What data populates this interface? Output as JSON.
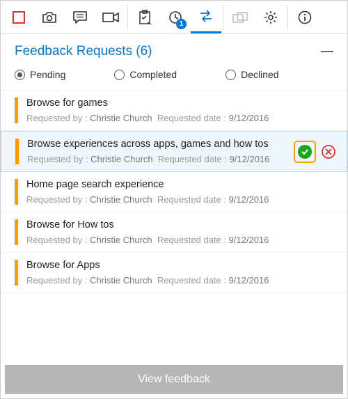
{
  "toolbar": {
    "badge_count": "1"
  },
  "header": {
    "title": "Feedback Requests (6)"
  },
  "filters": {
    "pending": "Pending",
    "completed": "Completed",
    "declined": "Declined",
    "selected": "pending"
  },
  "meta_labels": {
    "requested_by": "Requested by :",
    "requested_date": "Requested date :"
  },
  "items": [
    {
      "title": "Browse for games",
      "requested_by": "Christie Church",
      "requested_date": "9/12/2016"
    },
    {
      "title": "Browse experiences across apps, games and how tos",
      "requested_by": "Christie Church",
      "requested_date": "9/12/2016",
      "selected": true
    },
    {
      "title": "Home page search experience",
      "requested_by": "Christie Church",
      "requested_date": "9/12/2016"
    },
    {
      "title": "Browse for How tos",
      "requested_by": "Christie Church",
      "requested_date": "9/12/2016"
    },
    {
      "title": "Browse for Apps",
      "requested_by": "Christie Church",
      "requested_date": "9/12/2016"
    }
  ],
  "footer": {
    "view_feedback": "View feedback"
  }
}
